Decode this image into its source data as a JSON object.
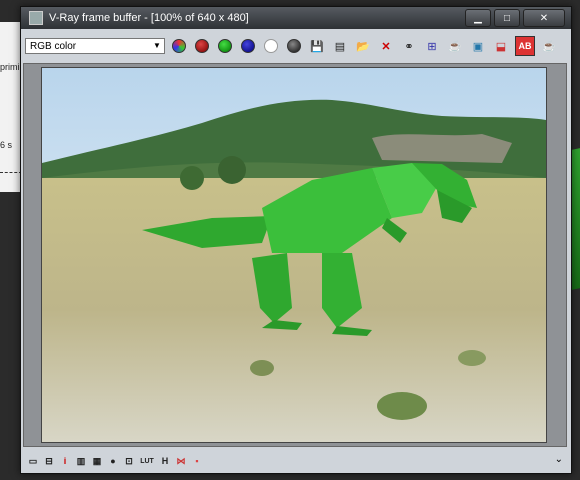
{
  "window": {
    "title": "V-Ray frame buffer - [100% of 640 x 480]",
    "minimize_glyph": "▁",
    "maximize_glyph": "□",
    "close_glyph": "✕"
  },
  "background": {
    "text1": "primi",
    "text2": "6 s"
  },
  "toolbar": {
    "channel_value": "RGB color",
    "dropdown_glyph": "▼",
    "buttons": [
      {
        "name": "show-rgb-button",
        "glyph": ""
      },
      {
        "name": "red-channel-button",
        "glyph": ""
      },
      {
        "name": "green-channel-button",
        "glyph": ""
      },
      {
        "name": "blue-channel-button",
        "glyph": ""
      },
      {
        "name": "alpha-channel-button",
        "glyph": ""
      },
      {
        "name": "mono-button",
        "glyph": ""
      },
      {
        "name": "save-image-button",
        "glyph": "💾"
      },
      {
        "name": "save-all-button",
        "glyph": "▤"
      },
      {
        "name": "load-image-button",
        "glyph": "📂"
      },
      {
        "name": "clear-image-button",
        "glyph": "✕"
      },
      {
        "name": "link-button",
        "glyph": "⚭"
      },
      {
        "name": "region-render-button",
        "glyph": "⊞"
      },
      {
        "name": "render-last-button",
        "glyph": "☕"
      },
      {
        "name": "display-corrected-button",
        "glyph": "▣"
      },
      {
        "name": "compare-button",
        "glyph": "⬓"
      },
      {
        "name": "ab-compare-button",
        "glyph": "AB"
      },
      {
        "name": "teapot-button",
        "glyph": "☕"
      }
    ]
  },
  "statusbar": {
    "buttons": [
      "▭",
      "⊟",
      "i",
      "▥",
      "▦",
      "●",
      "⊡",
      "LUT",
      "H",
      "⋈",
      "▪"
    ],
    "expand_glyph": "⌄"
  }
}
